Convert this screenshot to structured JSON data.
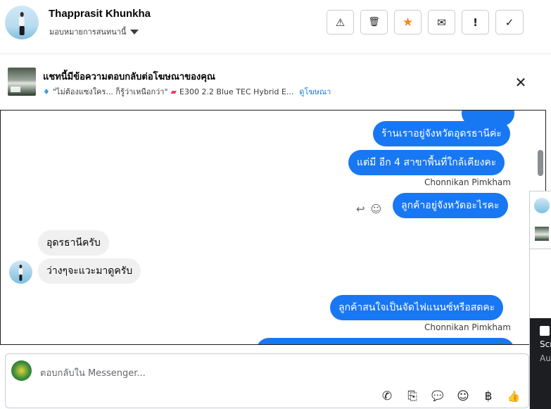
{
  "header": {
    "name": "Thapprasit Khunkha",
    "assign_label": "มอบหมายการสนทนานี้",
    "actions": [
      {
        "icon": "warning-icon",
        "glyph": "⚠"
      },
      {
        "icon": "trash-icon",
        "glyph": "🗑"
      },
      {
        "icon": "star-icon",
        "glyph": "★",
        "color": "#f08a24"
      },
      {
        "icon": "mail-open-icon",
        "glyph": "✉"
      },
      {
        "icon": "follow-up-icon",
        "glyph": "!"
      },
      {
        "icon": "check-icon",
        "glyph": "✓"
      }
    ]
  },
  "ad_banner": {
    "title": "แชทนี้มีข้อความตอบกลับต่อโฆษณาของคุณ",
    "snippet_quote": "\"ไม่ต้องแซงใคร... ก็รู้ว่าเหนือกว่า\"",
    "snippet_car": "E300 2.2 Blue TEC Hybrid E...",
    "view_ad_label": "ดูโฆษณา",
    "close_glyph": "✕"
  },
  "messages": [
    {
      "id": "m1",
      "direction": "out",
      "text": "ร้านเราอยู่จังหวัดอุดรธานีค่ะ"
    },
    {
      "id": "m2",
      "direction": "out",
      "text": "แต่มี อีก 4 สาขาพื้นที่ใกล้เคียงคะ"
    },
    {
      "id": "s1",
      "sender": "Chonnikan Pimkham"
    },
    {
      "id": "m3",
      "direction": "out",
      "text": "ลูกค้าอยู่จังหวัดอะไรคะ"
    },
    {
      "id": "m4",
      "direction": "in",
      "text": "อุดรธานีครับ"
    },
    {
      "id": "m5",
      "direction": "in",
      "text": "ว่างๆจะแวะมาดูครับ"
    },
    {
      "id": "m6",
      "direction": "out",
      "text": "ลูกค้าสนใจเป็นจัดไฟแนนซ์หรือสดคะ"
    },
    {
      "id": "s2",
      "sender": "Chonnikan Pimkham"
    }
  ],
  "reactions": {
    "reply_glyph": "↩",
    "emoji_glyph": "☺"
  },
  "side_panel": {
    "text1": "Scr",
    "text2": "Au"
  },
  "composer": {
    "placeholder": "ตอบกลับใน Messenger...",
    "tools": [
      {
        "icon": "add-call-icon",
        "glyph": "✆"
      },
      {
        "icon": "attachment-icon",
        "glyph": "⎘"
      },
      {
        "icon": "saved-reply-icon",
        "glyph": "💬"
      },
      {
        "icon": "emoji-icon",
        "glyph": "☺"
      },
      {
        "icon": "baht-icon",
        "glyph": "฿"
      },
      {
        "icon": "like-icon",
        "glyph": "👍"
      }
    ]
  },
  "colors": {
    "accent": "#1877f2",
    "star": "#f08a24"
  }
}
